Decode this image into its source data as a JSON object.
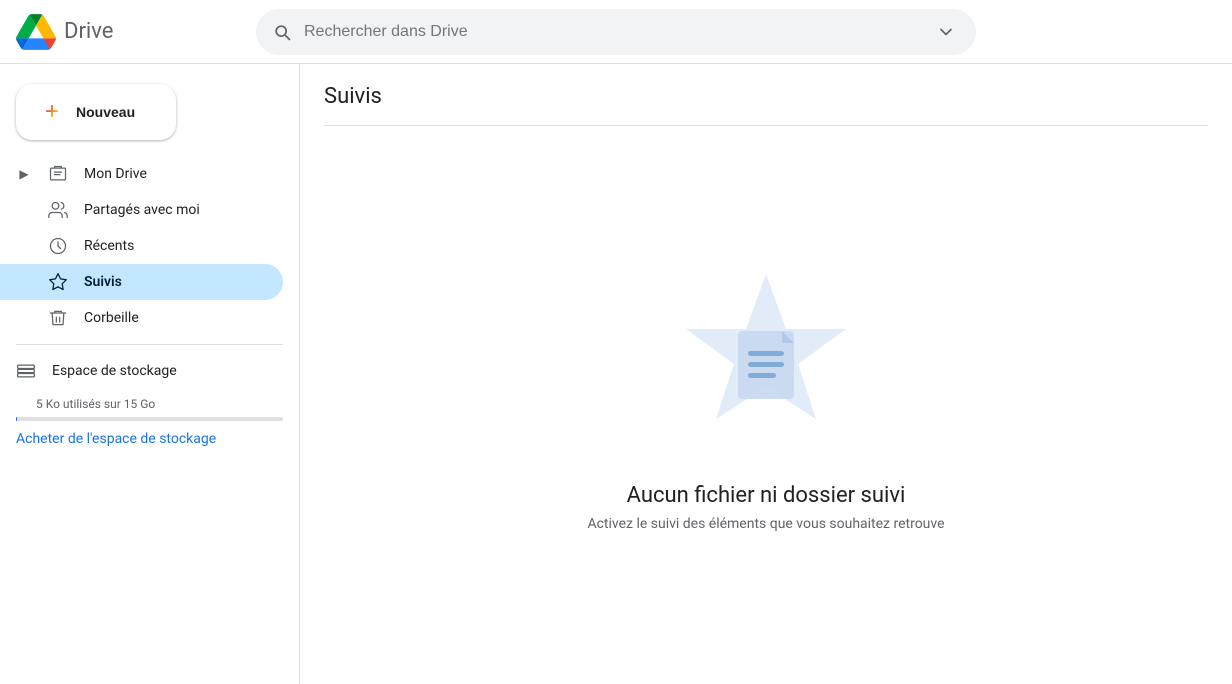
{
  "app": {
    "name": "Drive"
  },
  "header": {
    "search_placeholder": "Rechercher dans Drive"
  },
  "sidebar": {
    "new_button_label": "Nouveau",
    "items": [
      {
        "id": "mon-drive",
        "label": "Mon Drive",
        "icon": "🖼",
        "expandable": true,
        "active": false
      },
      {
        "id": "partages",
        "label": "Partagés avec moi",
        "icon": "👥",
        "expandable": false,
        "active": false
      },
      {
        "id": "recents",
        "label": "Récents",
        "icon": "🕐",
        "expandable": false,
        "active": false
      },
      {
        "id": "suivis",
        "label": "Suivis",
        "icon": "⭐",
        "expandable": false,
        "active": true
      },
      {
        "id": "corbeille",
        "label": "Corbeille",
        "icon": "🗑",
        "expandable": false,
        "active": false
      }
    ],
    "storage": {
      "label": "Espace de stockage",
      "used_text": "5 Ko utilisés sur 15 Go",
      "buy_link_text": "Acheter de l'espace de\nstockage",
      "fill_percent": 0.03
    }
  },
  "main": {
    "page_title": "Suivis",
    "empty_state": {
      "title": "Aucun fichier ni dossier suivi",
      "subtitle": "Activez le suivi des éléments que vous souhaitez retrouve"
    }
  }
}
